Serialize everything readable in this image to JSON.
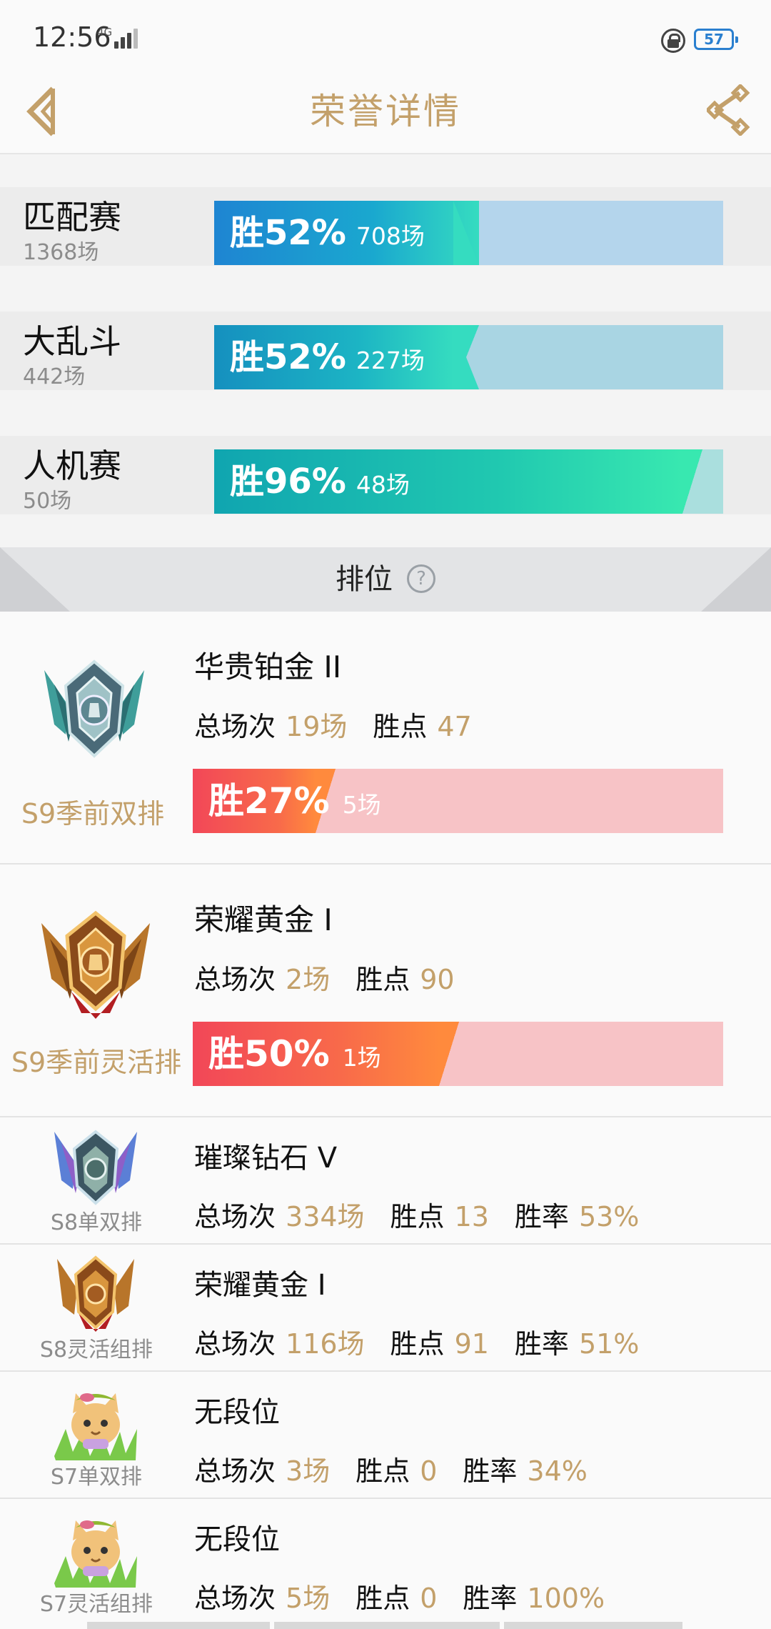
{
  "status_bar": {
    "time": "12:56",
    "network": "4G",
    "battery": "57"
  },
  "header": {
    "title": "荣誉详情"
  },
  "colors": {
    "accent_gold": "#c3a06a",
    "blue_fill": "#1e8fd8",
    "teal_fill": "#2ee0b0",
    "red_fill": "#f24c5c",
    "orange_fill": "#ff8a3d",
    "pink_track": "#f7c3c6"
  },
  "modes": [
    {
      "name": "匹配赛",
      "count": "1368场",
      "rate": "胜52%",
      "games": "708场",
      "win_fraction": 0.52
    },
    {
      "name": "大乱斗",
      "count": "442场",
      "rate": "胜52%",
      "games": "227场",
      "win_fraction": 0.52
    },
    {
      "name": "人机赛",
      "count": "50场",
      "rate": "胜96%",
      "games": "48场",
      "win_fraction": 0.96
    }
  ],
  "ranked": {
    "title": "排位",
    "help_icon": "?",
    "large_cards": [
      {
        "rank": "华贵铂金 II",
        "season": "S9季前双排",
        "total_label": "总场次",
        "total": "19场",
        "points_label": "胜点",
        "points": "47",
        "rate": "胜27%",
        "games": "5场",
        "win_fraction": 0.27,
        "badge": "platinum-badge-icon"
      },
      {
        "rank": "荣耀黄金 I",
        "season": "S9季前灵活排",
        "total_label": "总场次",
        "total": "2场",
        "points_label": "胜点",
        "points": "90",
        "rate": "胜50%",
        "games": "1场",
        "win_fraction": 0.5,
        "badge": "gold-badge-icon"
      }
    ],
    "small_cards": [
      {
        "rank": "璀璨钻石 V",
        "season": "S8单双排",
        "total_label": "总场次",
        "total": "334场",
        "points_label": "胜点",
        "points": "13",
        "rate_label": "胜率",
        "rate": "53%",
        "badge": "diamond-badge-icon"
      },
      {
        "rank": "荣耀黄金 I",
        "season": "S8灵活组排",
        "total_label": "总场次",
        "total": "116场",
        "points_label": "胜点",
        "points": "91",
        "rate_label": "胜率",
        "rate": "51%",
        "badge": "gold-badge-icon"
      },
      {
        "rank": "无段位",
        "season": "S7单双排",
        "total_label": "总场次",
        "total": "3场",
        "points_label": "胜点",
        "points": "0",
        "rate_label": "胜率",
        "rate": "34%",
        "badge": "unranked-cat-icon"
      },
      {
        "rank": "无段位",
        "season": "S7灵活组排",
        "total_label": "总场次",
        "total": "5场",
        "points_label": "胜点",
        "points": "0",
        "rate_label": "胜率",
        "rate": "100%",
        "badge": "unranked-cat-icon"
      }
    ]
  }
}
